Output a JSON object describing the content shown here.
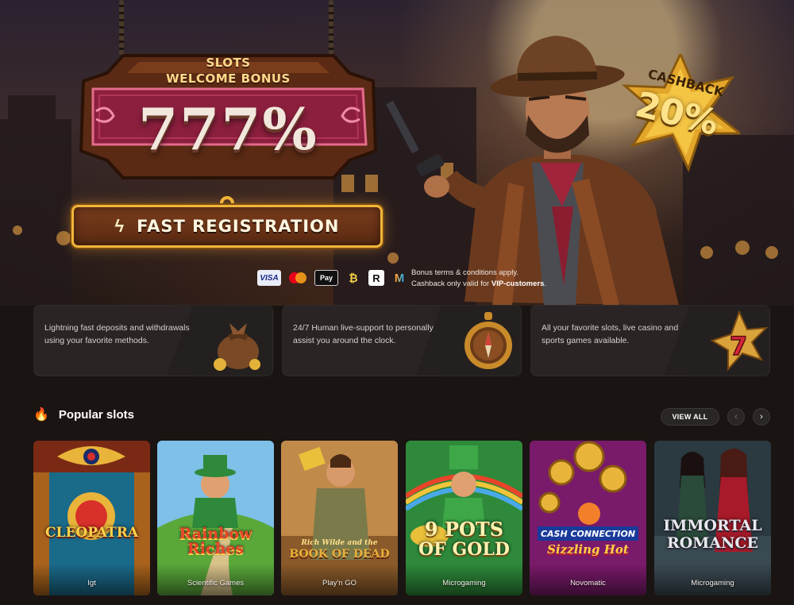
{
  "hero": {
    "sign_line1": "SLOTS",
    "sign_line2": "WELCOME BONUS",
    "sign_percent": "777%",
    "register_label": "FAST REGISTRATION",
    "cashback_label": "CASHBACK",
    "cashback_value": "20%",
    "terms_line1": "Bonus terms & conditions apply.",
    "terms_line2_prefix": "Cashback only valid for ",
    "terms_line2_bold": "VIP-customers",
    "terms_line2_suffix": ".",
    "payments": {
      "visa": "VISA",
      "mastercard": "mastercard-icon",
      "apple_pay": "Pay",
      "bitcoin": "bitcoin-icon",
      "revolut": "R",
      "muchbetter": "M"
    }
  },
  "features": [
    {
      "text": "Lightning fast deposits and withdrawals using your favorite methods.",
      "icon": "money-bag-icon"
    },
    {
      "text": "24/7 Human live-support to personally assist you around the clock.",
      "icon": "compass-icon"
    },
    {
      "text": "All your favorite slots, live casino and sports games available.",
      "icon": "lucky-seven-icon"
    }
  ],
  "popular": {
    "title": "Popular slots",
    "view_all": "VIEW ALL",
    "prev_icon": "‹",
    "next_icon": "›",
    "slots": [
      {
        "name": "CLEOPATRA",
        "provider": "Igt"
      },
      {
        "name": "Rainbow Riches",
        "provider": "Scientific Games"
      },
      {
        "name": "Rich Wilde and the",
        "name2": "BOOK OF DEAD",
        "provider": "Play'n GO"
      },
      {
        "name": "9 POTS",
        "name2": "OF GOLD",
        "provider": "Microgaming"
      },
      {
        "name": "CASH CONNECTION",
        "name2": "Sizzling Hot",
        "provider": "Novomatic"
      },
      {
        "name": "IMMORTAL",
        "name2": "ROMANCE",
        "provider": "Microgaming"
      }
    ]
  },
  "colors": {
    "background": "#1a1412",
    "gold": "#f1b63a",
    "sign_red": "#8c1f3e"
  }
}
